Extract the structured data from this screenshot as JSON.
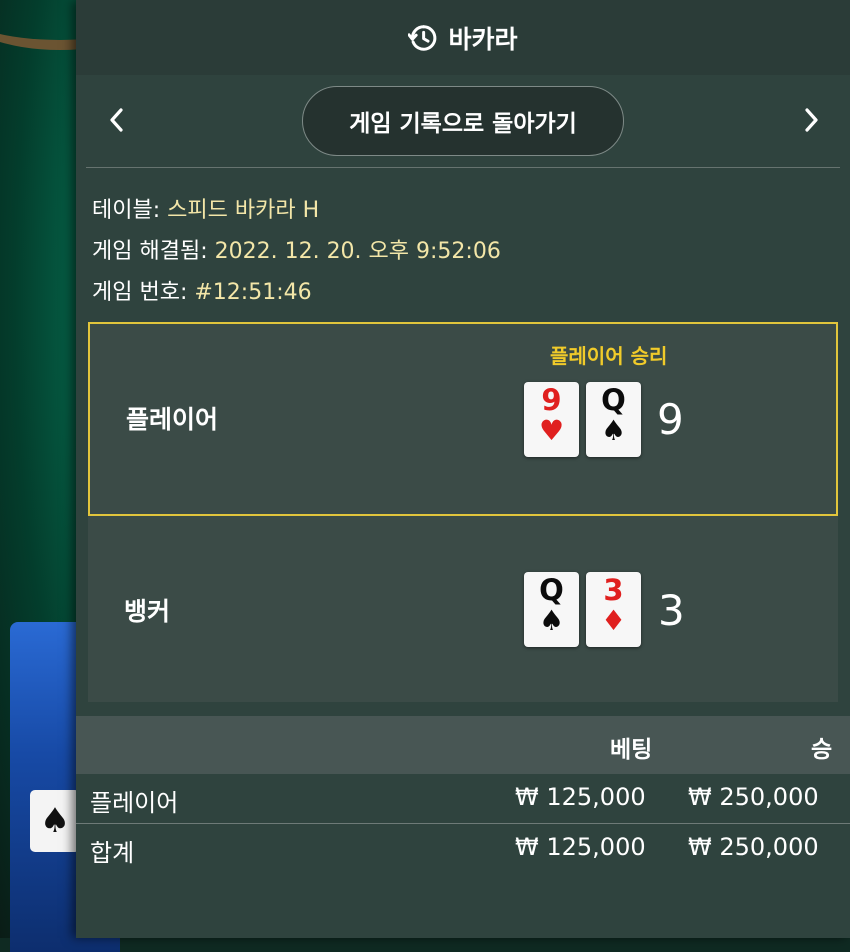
{
  "header": {
    "title": "바카라",
    "icon": "history-icon"
  },
  "nav": {
    "back_label": "게임 기록으로 돌아가기",
    "prev_icon": "chevron-left-icon",
    "next_icon": "chevron-right-icon"
  },
  "info": {
    "table_label": "테이블:",
    "table_value": "스피드 바카라 H",
    "resolved_label": "게임 해결됨:",
    "resolved_value": "2022. 12. 20. 오후 9:52:06",
    "number_label": "게임 번호:",
    "number_value": "#12:51:46"
  },
  "result": {
    "winner_text": "플레이어 승리",
    "player": {
      "label": "플레이어",
      "cards": [
        {
          "rank": "9",
          "suit": "♥",
          "color": "red"
        },
        {
          "rank": "Q",
          "suit": "♠",
          "color": "black"
        }
      ],
      "score": "9"
    },
    "banker": {
      "label": "뱅커",
      "cards": [
        {
          "rank": "Q",
          "suit": "♠",
          "color": "black"
        },
        {
          "rank": "3",
          "suit": "♦",
          "color": "red"
        }
      ],
      "score": "3"
    }
  },
  "bets": {
    "headers": {
      "bet": "베팅",
      "win": "승"
    },
    "rows": [
      {
        "label": "플레이어",
        "bet": "₩ 125,000",
        "win": "₩ 250,000"
      },
      {
        "label": "합계",
        "bet": "₩ 125,000",
        "win": "₩ 250,000"
      }
    ]
  },
  "colors": {
    "highlight_border": "#e1c53c",
    "winner_text": "#f1cb2a",
    "info_value": "#f3e6a8",
    "panel_bg": "#2f433e"
  }
}
